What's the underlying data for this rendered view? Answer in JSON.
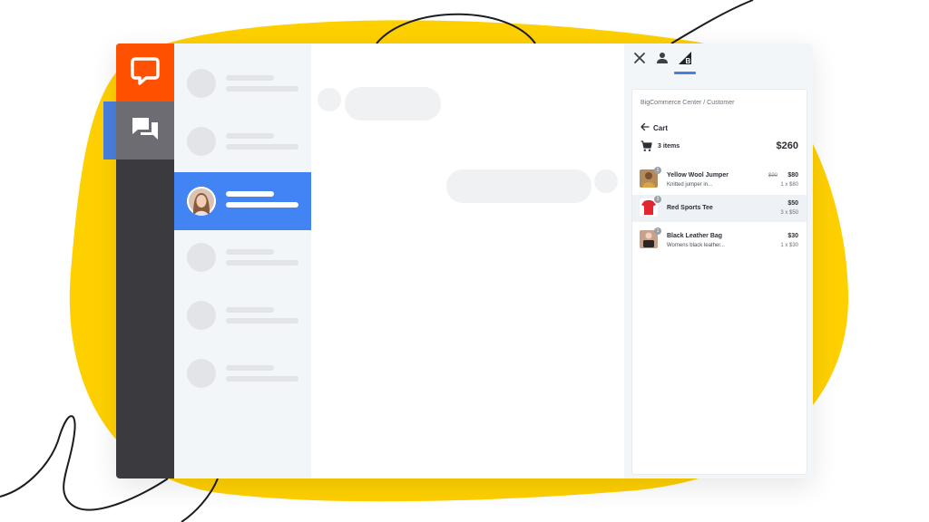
{
  "colors": {
    "brand_orange": "#ff5100",
    "accent_blue": "#4384f5",
    "blob_yellow": "#ffd000",
    "rail_dark": "#3b3a3f"
  },
  "rail": {
    "logo_icon": "speech-bubble-icon",
    "chats_icon": "chats-icon"
  },
  "details": {
    "tabs": [
      "close-icon",
      "customer-icon",
      "bigcommerce-icon"
    ],
    "breadcrumb": "BigCommerce Center / Customer",
    "back_label": "Cart",
    "cart_count": "3 items",
    "cart_total": "$260",
    "items": [
      {
        "name": "Yellow Wool Jumper",
        "description": "Knitted jumper in...",
        "old_price": "$90",
        "price": "$80",
        "qty": "1 x $80",
        "badge": "1"
      },
      {
        "name": "Red Sports Tee",
        "description": "",
        "old_price": "",
        "price": "$50",
        "qty": "3 x $50",
        "badge": "3"
      },
      {
        "name": "Black Leather Bag",
        "description": "Womens black leather...",
        "old_price": "",
        "price": "$30",
        "qty": "1 x $30",
        "badge": "1"
      }
    ]
  }
}
